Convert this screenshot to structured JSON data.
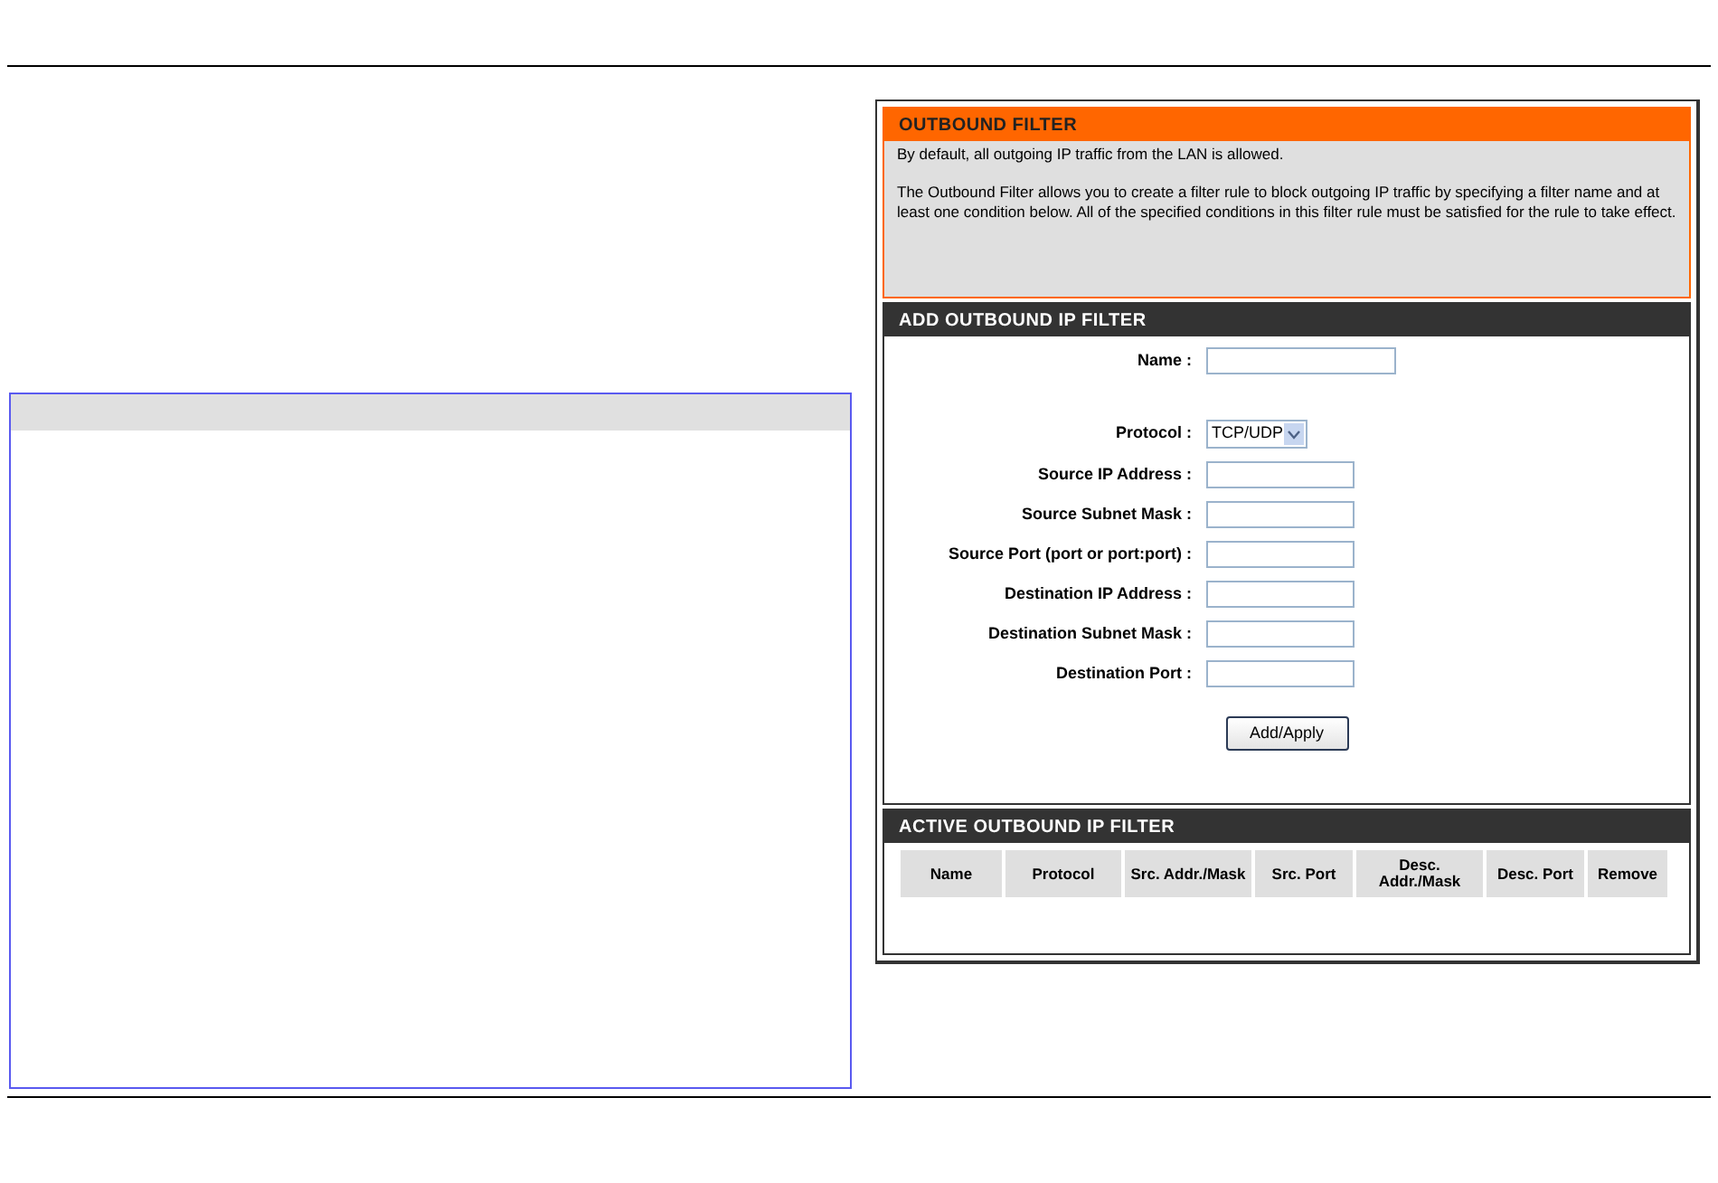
{
  "outbound_filter": {
    "title": "OUTBOUND FILTER",
    "paragraphs": [
      "By default, all outgoing IP traffic from the LAN is allowed.",
      "The Outbound Filter allows you to create a filter rule to block outgoing IP traffic by specifying a filter name and at least one condition below. All of the specified conditions in this filter rule must be satisfied for the rule to take effect."
    ]
  },
  "add_filter": {
    "title": "ADD OUTBOUND IP FILTER",
    "fields": [
      {
        "label": "Name :",
        "kind": "wide_text"
      },
      {
        "label": "Protocol :",
        "kind": "select",
        "value": "TCP/UDP"
      },
      {
        "label": "Source IP Address :",
        "kind": "text"
      },
      {
        "label": "Source Subnet Mask :",
        "kind": "text"
      },
      {
        "label": "Source Port (port or port:port) :",
        "kind": "text"
      },
      {
        "label": "Destination IP Address :",
        "kind": "text"
      },
      {
        "label": "Destination Subnet Mask :",
        "kind": "text"
      },
      {
        "label": "Destination Port :",
        "kind": "text"
      }
    ],
    "button": "Add/Apply"
  },
  "active_filter": {
    "title": "ACTIVE OUTBOUND IP FILTER",
    "columns": [
      "Name",
      "Protocol",
      "Src. Addr./Mask",
      "Src. Port",
      "Desc. Addr./Mask",
      "Desc. Port",
      "Remove"
    ]
  }
}
